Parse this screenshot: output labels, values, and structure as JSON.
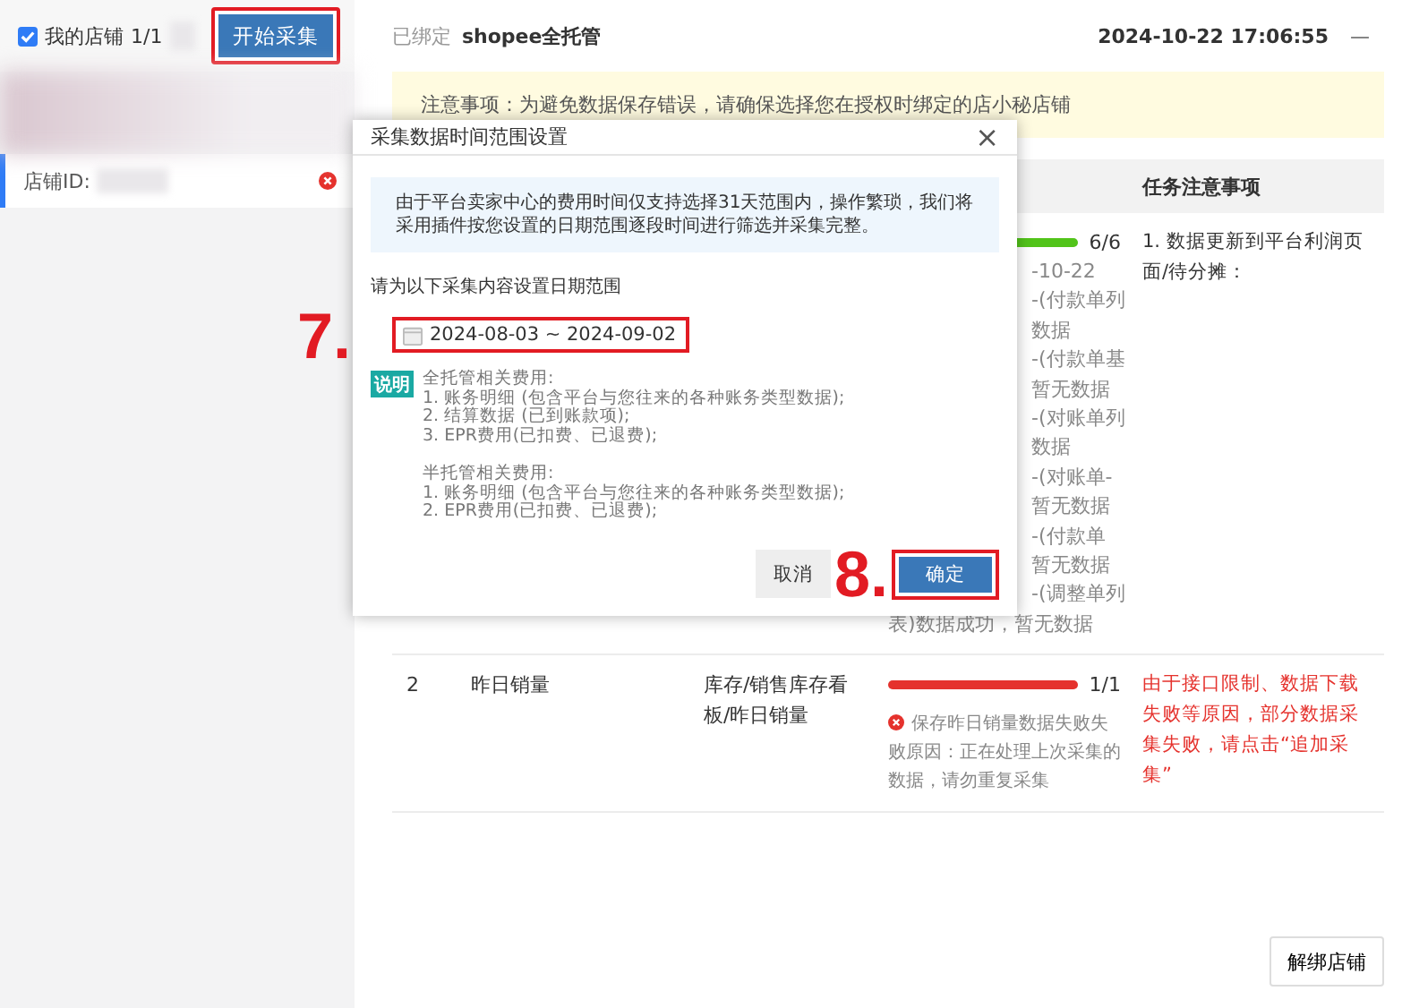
{
  "sidebar": {
    "select_all": {
      "label": "我的店铺",
      "checked": true,
      "count": "1/1"
    },
    "start_button": {
      "label": "开始采集",
      "highlighted": true
    },
    "stores": [
      {
        "label": "店铺ID:",
        "selected": true,
        "error": true
      }
    ]
  },
  "header": {
    "bound_label": "已绑定",
    "platform": "shopee全托管",
    "datetime": "2024-10-22 17:06:55",
    "minimize": "—"
  },
  "notice": "注意事项：为避免数据保存错误，请确保选择您在授权时绑定的店小秘店铺",
  "table": {
    "columns": [
      {
        "label": "任务注意事项"
      }
    ],
    "rows": [
      {
        "progress": {
          "level": 1,
          "text": "6/6",
          "color": "#52c41a"
        },
        "status_lines": [
          {
            "kind": "partial",
            "text": "-10-22"
          },
          {
            "kind": "partial",
            "text": "-(付款单列"
          },
          {
            "kind": "partial",
            "text": "数据"
          },
          {
            "kind": "partial",
            "text": "-(付款单基"
          },
          {
            "kind": "partial",
            "text": "暂无数据"
          },
          {
            "kind": "partial",
            "text": "-(对账单列"
          },
          {
            "kind": "partial",
            "text": "数据"
          },
          {
            "kind": "partial",
            "text": "-(对账单-"
          },
          {
            "kind": "partial",
            "text": "暂无数据"
          },
          {
            "kind": "partial",
            "text": "-(付款单"
          },
          {
            "kind": "partial",
            "text": "暂无数据"
          },
          {
            "kind": "partial",
            "text": "-(调整单列"
          },
          {
            "kind": "full",
            "text": "表)数据成功，暂无数据"
          }
        ],
        "note": "1. 数据更新到平台利润页面/待分摊：",
        "note_error": false
      },
      {
        "index": "2",
        "name": "昨日销量",
        "path": "库存/销售库存看板/昨日销量",
        "progress": {
          "level": 1,
          "text": "1/1",
          "color": "#e5322d"
        },
        "status_lines": [
          {
            "kind": "error",
            "text": "保存昨日销量数据失败失败原因：正在处理上次采集的数据，请勿重复采集"
          }
        ],
        "note": "由于接口限制、数据下载失败等原因，部分数据采集失败，请点击“追加采集”",
        "note_error": true
      }
    ]
  },
  "unbind_button": "解绑店铺",
  "dialog": {
    "title": "采集数据时间范围设置",
    "close": "×",
    "info": "由于平台卖家中心的费用时间仅支持选择31天范围内，操作繁琐，我们将采用插件按您设置的日期范围逐段时间进行筛选并采集完整。",
    "prompt": "请为以下采集内容设置日期范围",
    "date_range": {
      "value": "2024-08-03 ~ 2024-09-02",
      "highlighted": true
    },
    "badge": "说明",
    "notes": [
      [
        "全托管相关费用:",
        "1. 账务明细 (包含平台与您往来的各种账务类型数据);",
        "2. 结算数据 (已到账款项);",
        "3. EPR费用(已扣费、已退费);"
      ],
      [
        "半托管相关费用:",
        "1. 账务明细 (包含平台与您往来的各种账务类型数据);",
        "2. EPR费用(已扣费、已退费);"
      ]
    ],
    "cancel": "取消",
    "confirm": {
      "label": "确定",
      "highlighted": true
    }
  },
  "annotations": [
    "7.",
    "8."
  ]
}
